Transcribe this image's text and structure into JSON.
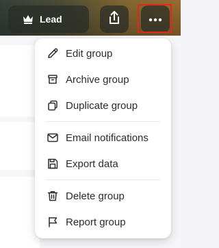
{
  "header": {
    "role_label": "Lead",
    "share_button_icon": "share-icon",
    "more_button_icon": "more-horizontal-icon"
  },
  "menu": {
    "items": [
      {
        "label": "Edit group",
        "icon": "pencil-icon"
      },
      {
        "label": "Archive group",
        "icon": "archive-icon"
      },
      {
        "label": "Duplicate group",
        "icon": "copy-icon"
      },
      {
        "label": "Email notifications",
        "icon": "mail-icon"
      },
      {
        "label": "Export data",
        "icon": "save-icon"
      },
      {
        "label": "Delete group",
        "icon": "trash-icon"
      },
      {
        "label": "Report group",
        "icon": "flag-icon"
      }
    ]
  },
  "colors": {
    "highlight": "#e0281f",
    "text": "#2b2b2e",
    "chip_bg": "rgba(40,44,40,0.72)"
  }
}
